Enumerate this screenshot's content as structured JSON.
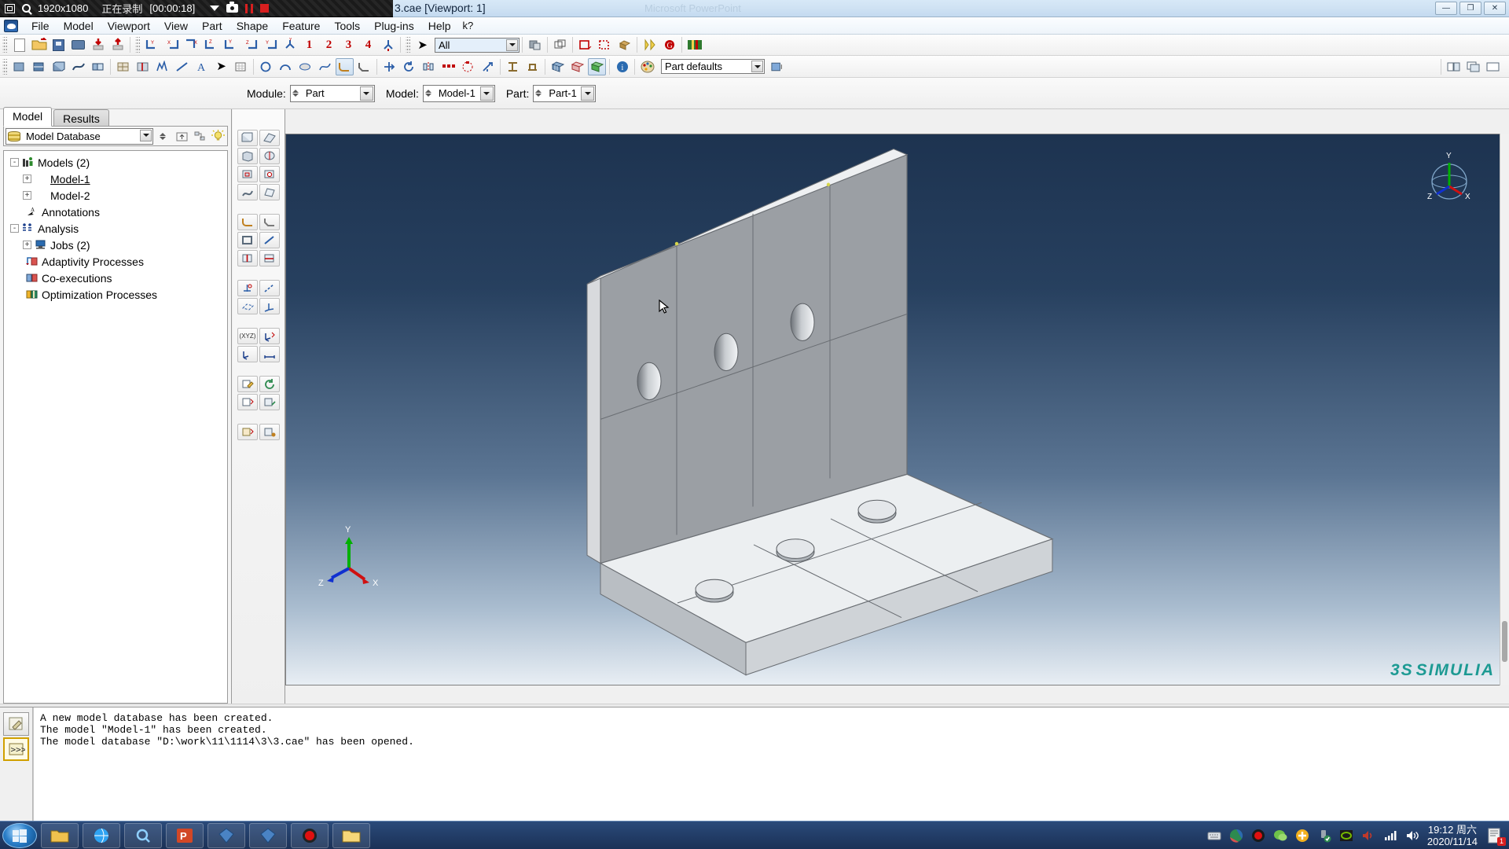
{
  "recorder": {
    "resolution": "1920x1080",
    "status": "正在录制",
    "time": "[00:00:18]",
    "icons": [
      "window-icon",
      "magnifier-icon",
      "chevron-down-icon",
      "camera-icon",
      "pause-icon",
      "stop-icon"
    ]
  },
  "titlebar": {
    "title": "3.cae [Viewport: 1]",
    "ghost_window": "Microsoft PowerPoint",
    "buttons": {
      "minimize": "—",
      "maximize": "❐",
      "close": "✕"
    }
  },
  "menubar": {
    "app_icon": "abaqus-logo-icon",
    "items": [
      {
        "label": "File",
        "accel": "F"
      },
      {
        "label": "Model",
        "accel": "M"
      },
      {
        "label": "Viewport",
        "accel": "V"
      },
      {
        "label": "View",
        "accel": "V"
      },
      {
        "label": "Part",
        "accel": "P"
      },
      {
        "label": "Shape",
        "accel": "S"
      },
      {
        "label": "Feature",
        "accel": "t"
      },
      {
        "label": "Tools",
        "accel": "T"
      },
      {
        "label": "Plug-ins",
        "accel": "g"
      },
      {
        "label": "Help",
        "accel": "H"
      }
    ],
    "help_cursor": "k?"
  },
  "toolbar_row1": {
    "file_group": [
      "new-file-icon",
      "open-file-icon",
      "save-icon",
      "print-icon",
      "import-icon",
      "export-icon"
    ],
    "view_group": [
      "view-front-icon",
      "view-back-icon",
      "view-iso-icon",
      "view-top-icon",
      "view-bottom-icon",
      "view-left-icon",
      "view-right-icon",
      "view-default-icon"
    ],
    "saved_views": [
      "1",
      "2",
      "3",
      "4"
    ],
    "apply_view_icon": "apply-view-icon",
    "selection_filter": {
      "value": "All",
      "placeholder": "All"
    },
    "selection_group": [
      "select-entity-icon",
      "display-group-icon",
      "create-display-group-icon",
      "replace-display-group-icon"
    ],
    "render_group": [
      "render-wireframe-icon",
      "render-hidden-icon",
      "render-shaded-icon"
    ],
    "extra_group": [
      "color-code-icon",
      "geometry-diagnostics-icon",
      "partition-icon",
      "ply-stack-icon"
    ]
  },
  "toolbar_row2": {
    "group_a": [
      "create-part-icon",
      "create-shell-icon",
      "create-solid-icon",
      "create-wire-icon",
      "create-cut-icon",
      "create-blend-icon",
      "merge-icon"
    ],
    "group_b": [
      "query-icon",
      "datum-icon",
      "set-icon",
      "partition-cell-icon",
      "sketch-icon",
      "text-icon",
      "pointer-icon",
      "grid-icon"
    ],
    "group_c": [
      "circle-icon",
      "arc-icon",
      "fillet-icon",
      "spline-icon",
      "ellipse-icon",
      "chamfer-icon",
      "offset-icon"
    ],
    "group_d": [
      "translate-icon",
      "rotate-icon",
      "mirror-icon",
      "pattern-linear-icon",
      "pattern-radial-icon",
      "scale-icon"
    ],
    "group_e": [
      "beam-section-icon",
      "truss-icon"
    ],
    "group_f": [
      "mesh-part-icon",
      "seed-part-icon",
      "verify-mesh-icon"
    ],
    "info_icon": "info-icon",
    "color_icon": "color-palette-icon",
    "part_defaults": {
      "value": "Part defaults"
    },
    "color_swatch_icon": "color-swatch-icon",
    "right_group": [
      "viewport-tile-icon",
      "viewport-cascade-icon",
      "viewport-single-icon"
    ]
  },
  "context_bar": {
    "module": {
      "label": "Module:",
      "value": "Part"
    },
    "model": {
      "label": "Model:",
      "value": "Model-1"
    },
    "part": {
      "label": "Part:",
      "value": "Part-1"
    }
  },
  "left_panel": {
    "tabs": [
      {
        "label": "Model",
        "active": true
      },
      {
        "label": "Results",
        "active": false
      }
    ],
    "tree_selector": {
      "value": "Model Database",
      "icon": "database-icon"
    },
    "tree_buttons": [
      "spinner-icon",
      "up-level-icon",
      "filter-icon",
      "lightbulb-icon"
    ],
    "tree": [
      {
        "label": "Models (2)",
        "depth": 0,
        "expander": "-",
        "icon": "models-icon",
        "underline": false
      },
      {
        "label": "Model-1",
        "depth": 1,
        "expander": "+",
        "icon": "model-icon",
        "underline": true
      },
      {
        "label": "Model-2",
        "depth": 1,
        "expander": "+",
        "icon": "model-icon",
        "underline": false
      },
      {
        "label": "Annotations",
        "depth": 1,
        "expander": "",
        "icon": "annotations-icon",
        "underline": false
      },
      {
        "label": "Analysis",
        "depth": 0,
        "expander": "-",
        "icon": "analysis-icon",
        "underline": false
      },
      {
        "label": "Jobs (2)",
        "depth": 1,
        "expander": "+",
        "icon": "jobs-icon",
        "underline": false
      },
      {
        "label": "Adaptivity Processes",
        "depth": 1,
        "expander": "",
        "icon": "adaptivity-icon",
        "underline": false
      },
      {
        "label": "Co-executions",
        "depth": 1,
        "expander": "",
        "icon": "coexecution-icon",
        "underline": false
      },
      {
        "label": "Optimization Processes",
        "depth": 1,
        "expander": "",
        "icon": "optimization-icon",
        "underline": false
      }
    ]
  },
  "module_toolbox": {
    "rows": [
      [
        "create-part-icon",
        "create-shell-extrude-icon"
      ],
      [
        "create-solid-extrude-icon",
        "create-solid-revolve-icon"
      ],
      [
        "create-cut-extrude-icon",
        "create-cut-revolve-icon"
      ],
      [
        "create-blend-icon",
        "create-shell-loft-icon"
      ],
      [
        "create-round-icon",
        "create-chamfer-icon"
      ],
      [
        "create-shell-from-solid-icon",
        "create-wire-icon"
      ],
      [
        "partition-cell-icon",
        "partition-face-icon"
      ],
      [
        "create-datum-point-icon",
        "create-datum-axis-icon"
      ],
      [
        "create-datum-plane-icon",
        "create-datum-csys-icon"
      ],
      [
        "create-set-icon",
        "create-surface-icon"
      ],
      [
        "query-information-icon",
        "measure-distance-icon"
      ],
      [
        "edit-feature-icon",
        "regenerate-icon"
      ],
      [
        "delete-feature-icon",
        "suppress-feature-icon"
      ]
    ],
    "csys_label": "(XYZ)"
  },
  "viewport": {
    "title": "Viewport: 1",
    "triad": {
      "x": "X",
      "y": "Y",
      "z": "Z"
    },
    "nav_triad": {
      "x": "X",
      "y": "Y",
      "z": "Z"
    },
    "branding": "SIMULIA",
    "branding_mark": "3S",
    "model_note": "L-shaped plate assembly with circular holes"
  },
  "message_area": {
    "buttons": [
      "message-log-icon",
      "python-prompt-icon"
    ],
    "lines": [
      "A new model database has been created.",
      "The model \"Model-1\" has been created.",
      "The model database \"D:\\work\\11\\1114\\3\\3.cae\" has been opened."
    ]
  },
  "taskbar": {
    "start_label": "start-orb-icon",
    "apps": [
      "folder-explorer-icon",
      "browser-icon",
      "powerpoint-icon",
      "abaqus-icon",
      "abaqus-icon-2",
      "recorder-icon",
      "file-explorer-icon"
    ],
    "tray_icons": [
      "keyboard-icon",
      "graphics-icon",
      "recorder-red-icon",
      "wechat-icon",
      "updater-icon",
      "usb-safe-icon",
      "nvidia-icon",
      "volume-mute-icon",
      "network-icon",
      "speaker-icon"
    ],
    "clock": {
      "time": "19:12 周六",
      "date": "2020/11/14"
    },
    "notification_badge": "1"
  },
  "colors": {
    "accent": "#1c9a93",
    "toolbar_red": "#c00000",
    "viewport_top": "#1d3350",
    "viewport_bottom": "#e8eef4",
    "taskbar": "#24406c",
    "recorder_red": "#d81f1f"
  }
}
